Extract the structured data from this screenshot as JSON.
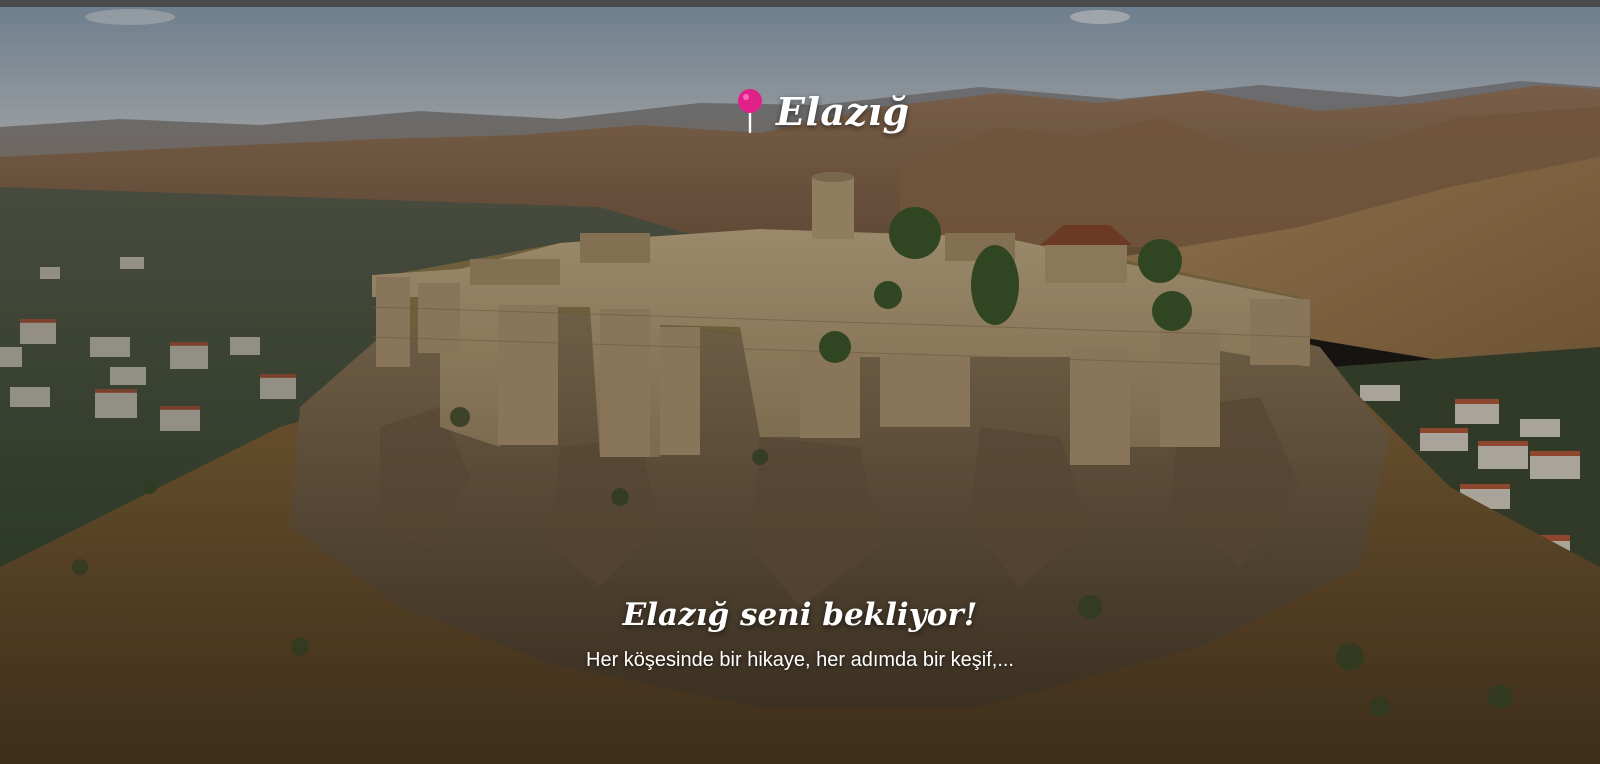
{
  "hero": {
    "brand": {
      "icon": "map-pin-icon",
      "title": "Elazığ",
      "pin_color": "#e0218a"
    },
    "tagline": "Elazığ seni bekliyor!",
    "subtitle": "Her köşesinde bir hikaye, her adımda bir keşif,...",
    "background_image": "harput-castle-landscape"
  },
  "colors": {
    "topbar": "#4a4a4a",
    "text": "#ffffff"
  }
}
